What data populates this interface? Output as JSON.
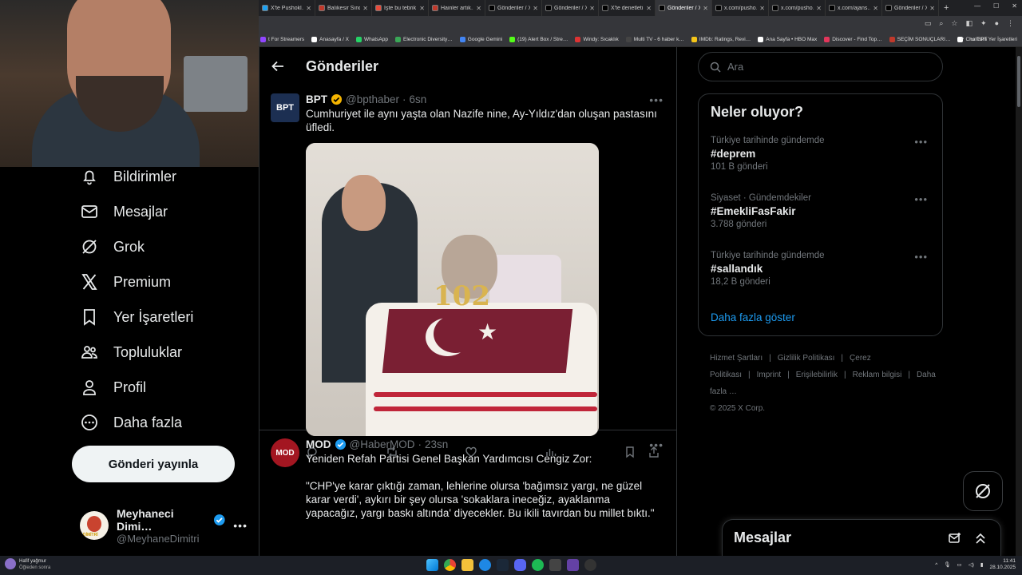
{
  "browser": {
    "tabs": [
      {
        "label": "X'te Pushokl…",
        "color": "#1da1f2",
        "active": false
      },
      {
        "label": "Balıkesir Sındı…",
        "color": "#c0392b",
        "active": false
      },
      {
        "label": "İşte bu tebrik…",
        "color": "#e74c3c",
        "active": false
      },
      {
        "label": "Hainler artık…",
        "color": "#c0392b",
        "active": false
      },
      {
        "label": "Gönderiler / X",
        "color": "#000000",
        "active": false
      },
      {
        "label": "Gönderiler / X",
        "color": "#000000",
        "active": false
      },
      {
        "label": "X'te denetleti…",
        "color": "#000000",
        "active": false
      },
      {
        "label": "Gönderiler / X",
        "color": "#000000",
        "active": true
      },
      {
        "label": "x.com/pusho…",
        "color": "#000000",
        "active": false
      },
      {
        "label": "x.com/pusho…",
        "color": "#000000",
        "active": false
      },
      {
        "label": "x.com/ajans…",
        "color": "#000000",
        "active": false
      },
      {
        "label": "Gönderiler / X",
        "color": "#000000",
        "active": false
      }
    ],
    "new_tab": "+",
    "bookmarks": [
      {
        "label": "t For Streamers",
        "color": "#9146ff"
      },
      {
        "label": "Anasayfa / X",
        "color": "#ffffff"
      },
      {
        "label": "WhatsApp",
        "color": "#25d366"
      },
      {
        "label": "Electronic Diversity…",
        "color": "#3aa757"
      },
      {
        "label": "Google Gemini",
        "color": "#4285f4"
      },
      {
        "label": "(19) Alert Box / Stre…",
        "color": "#53fc18"
      },
      {
        "label": "Windy: Sıcaklık",
        "color": "#d33"
      },
      {
        "label": "Multi TV - 6 haber k…",
        "color": "#444"
      },
      {
        "label": "IMDb: Ratings, Revi…",
        "color": "#f5c518"
      },
      {
        "label": "Ana Sayfa • HBO Max",
        "color": "#fff"
      },
      {
        "label": "Discover - Find Top…",
        "color": "#e2365b"
      },
      {
        "label": "SEÇİM SONUÇLARI…",
        "color": "#c0392b"
      },
      {
        "label": "ChatGPT",
        "color": "#fff"
      }
    ],
    "bookmarks_more": "»",
    "all_bookmarks": "Tüm Yer İşaretleri"
  },
  "sidebar": {
    "items": [
      {
        "label": "Bildirimler",
        "icon": "bell-icon"
      },
      {
        "label": "Mesajlar",
        "icon": "mail-icon"
      },
      {
        "label": "Grok",
        "icon": "grok-icon"
      },
      {
        "label": "Premium",
        "icon": "x-logo-icon"
      },
      {
        "label": "Yer İşaretleri",
        "icon": "bookmark-icon"
      },
      {
        "label": "Topluluklar",
        "icon": "communities-icon"
      },
      {
        "label": "Profil",
        "icon": "person-icon"
      },
      {
        "label": "Daha fazla",
        "icon": "more-circle-icon"
      }
    ],
    "post_button": "Gönderi yayınla",
    "account": {
      "name": "Meyhaneci Dimi…",
      "handle": "@MeyhaneDimitri",
      "avatar_text": "DİMİTRİ"
    }
  },
  "timeline": {
    "title": "Gönderiler",
    "tweets": [
      {
        "name": "BPT",
        "handle": "@bpthaber",
        "time": "6sn",
        "avatar_text": "BPT",
        "text": "Cumhuriyet ile aynı yaşta olan Nazife nine, Ay-Yıldız'dan oluşan pastasını üfledi.",
        "image_candles": "102"
      },
      {
        "name": "MOD",
        "handle": "@HaberMOD",
        "time": "23sn",
        "avatar_text": "MOD",
        "text_1": "Yeniden Refah Partisi Genel Başkan Yardımcısı Cengiz Zor:",
        "text_2": "\"CHP'ye karar çıktığı zaman, lehlerine olursa 'bağımsız yargı, ne güzel karar verdi', aykırı bir şey olursa 'sokaklara ineceğiz, ayaklanma yapacağız, yargı baskı altında' diyecekler. Bu ikili tavırdan bu millet bıktı.\""
      }
    ]
  },
  "search": {
    "placeholder": "Ara"
  },
  "trends": {
    "title": "Neler oluyor?",
    "items": [
      {
        "context": "Türkiye tarihinde gündemde",
        "name": "#deprem",
        "count": "101 B gönderi"
      },
      {
        "context": "Siyaset · Gündemdekiler",
        "name": "#EmekliFasFakir",
        "count": "3.788 gönderi"
      },
      {
        "context": "Türkiye tarihinde gündemde",
        "name": "#sallandık",
        "count": "18,2 B gönderi"
      }
    ],
    "show_more": "Daha fazla göster"
  },
  "footer": {
    "links": [
      "Hizmet Şartları",
      "|",
      "Gizlilik Politikası",
      "|",
      "Çerez Politikası",
      "|",
      "Imprint",
      "|",
      "Erişilebilirlik",
      "|",
      "Reklam bilgisi",
      "|",
      "Daha fazla …"
    ],
    "copyright": "© 2025 X Corp."
  },
  "messages_drawer": {
    "title": "Mesajlar"
  },
  "taskbar": {
    "weather_title": "Hafif yağmur",
    "weather_sub": "Öğleden sonra",
    "time": "11:41",
    "date": "28.10.2025"
  },
  "colors": {
    "accent": "#1d9bf0",
    "verified": "#f4b400",
    "verified_blue": "#1d9bf0",
    "border": "#2f3336",
    "muted": "#71767b"
  }
}
